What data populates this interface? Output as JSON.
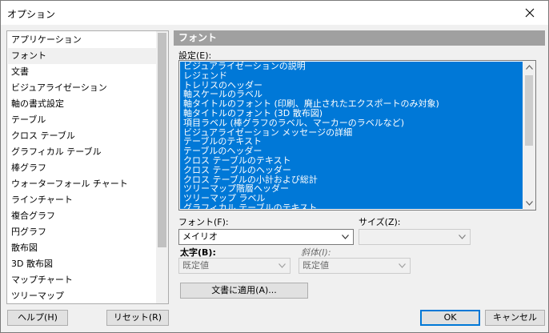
{
  "window": {
    "title": "オプション"
  },
  "categories": [
    "アプリケーション",
    "フォント",
    "文書",
    "ビジュアライゼーション",
    "軸の書式設定",
    "テーブル",
    "クロス テーブル",
    "グラフィカル テーブル",
    "棒グラフ",
    "ウォーターフォール チャート",
    "ラインチャート",
    "複合グラフ",
    "円グラフ",
    "散布図",
    "3D 散布図",
    "マップチャート",
    "ツリーマップ"
  ],
  "selected_category_index": 1,
  "panel": {
    "header": "フォント",
    "settings_label": "設定(E):",
    "settings_items": [
      "ビジュアライゼーションの説明",
      "レジェンド",
      "トレリスのヘッダー",
      "軸スケールのラベル",
      "軸タイトルのフォント (印刷、廃止されたエクスポートのみ対象)",
      "軸タイトルのフォント (3D 散布図)",
      "項目ラベル (棒グラフのラベル、マーカーのラベルなど)",
      "ビジュアライゼーション メッセージの詳細",
      "テーブルのテキスト",
      "テーブルのヘッダー",
      "クロス テーブルのテキスト",
      "クロス テーブルのヘッダー",
      "クロス テーブルの小計および総計",
      "ツリーマップ階層ヘッダー",
      "ツリーマップ ラベル",
      "グラフィカル テーブルのテキスト"
    ],
    "font_label": "フォント(F):",
    "font_value": "メイリオ",
    "size_label": "サイズ(Z):",
    "size_value": "",
    "bold_label": "太字(B):",
    "bold_value": "既定値",
    "italic_label": "斜体(I):",
    "italic_value": "既定値",
    "apply_button": "文書に適用(A)..."
  },
  "footer": {
    "help": "ヘルプ(H)",
    "reset": "リセット(R)",
    "ok": "OK",
    "cancel": "キャンセル"
  },
  "colors": {
    "selection": "#0078d7",
    "header_bg": "#a0a0a0",
    "dialog_bg": "#f0f0f0"
  }
}
